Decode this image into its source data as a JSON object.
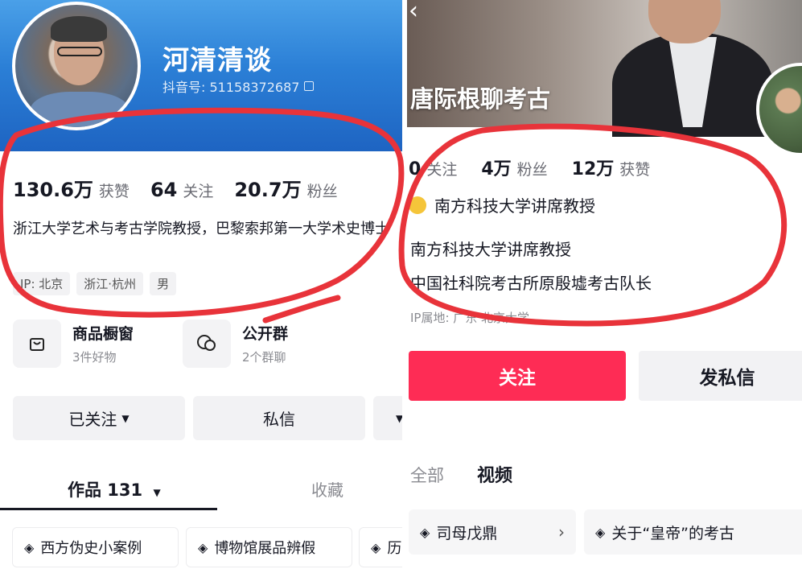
{
  "left": {
    "name": "河清清谈",
    "douyin_id": "抖音号: 51158372687",
    "stats": [
      {
        "num": "130.6万",
        "label": "获赞"
      },
      {
        "num": "64",
        "label": "关注"
      },
      {
        "num": "20.7万",
        "label": "粉丝"
      }
    ],
    "bio": "浙江大学艺术与考古学院教授，巴黎索邦第一大学术史博士",
    "tags": [
      "IP: 北京",
      "浙江·杭州",
      "男"
    ],
    "shop": {
      "title": "商品橱窗",
      "sub": "3件好物"
    },
    "group": {
      "title": "公开群",
      "sub": "2个群聊"
    },
    "followed_label": "已关注",
    "message_label": "私信",
    "tab_works": "作品 131",
    "tab_fav": "收藏",
    "chips": [
      "西方伪史小案例",
      "博物馆展品辨假",
      "历"
    ]
  },
  "right": {
    "name": "唐际根聊考古",
    "stats": [
      {
        "num": "0",
        "label": "关注"
      },
      {
        "num": "4万",
        "label": "粉丝"
      },
      {
        "num": "12万",
        "label": "获赞"
      }
    ],
    "verified": "南方科技大学讲席教授",
    "bio_line1": "南方科技大学讲席教授",
    "bio_line2": "中国社科院考古所原殷墟考古队长",
    "ip_line": "IP属地: 广东    北京大学",
    "follow_label": "关注",
    "message_label": "发私信",
    "tab_all": "全部",
    "tab_video": "视频",
    "chip1": "司母戊鼎",
    "chip2": "关于“皇帝”的考古"
  },
  "colors": {
    "accent_red": "#fe2c55",
    "annotation_red": "#e8333a",
    "header_blue": "#2b7fd6"
  }
}
